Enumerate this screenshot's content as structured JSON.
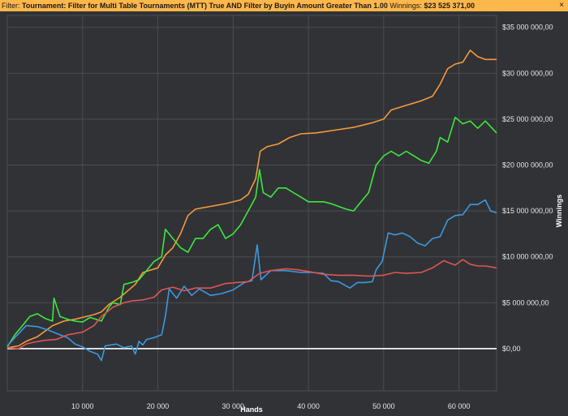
{
  "filter": {
    "label": "Filter:",
    "text": "Tournament: Filter for Multi Table Tournaments (MTT) True AND Filter by Buyin Amount Greater Than 1.00",
    "winnings_label": "Winnings:",
    "winnings_value": "$23 525 371,00",
    "close_glyph": "×"
  },
  "chart_data": {
    "type": "line",
    "xlabel": "Hands",
    "ylabel": "Winnings",
    "xlim": [
      0,
      65000
    ],
    "ylim": [
      -4600000,
      36300000
    ],
    "x_ticks": [
      10000,
      20000,
      30000,
      40000,
      50000,
      60000
    ],
    "x_tick_labels": [
      "10 000",
      "20 000",
      "30 000",
      "40 000",
      "50 000",
      "60 000"
    ],
    "y_ticks": [
      0,
      5000000,
      10000000,
      15000000,
      20000000,
      25000000,
      30000000,
      35000000
    ],
    "y_tick_labels": [
      "$0,00",
      "$5 000 000,00",
      "$10 000 000,00",
      "$15 000 000,00",
      "$20 000 000,00",
      "$25 000 000,00",
      "$30 000 000,00",
      "$35 000 000,00"
    ],
    "grid": true,
    "zero_line": true,
    "background": "#303236",
    "grid_color": "#4a4d52",
    "series": [
      {
        "color": "#f59a3b",
        "points": [
          [
            0,
            100000
          ],
          [
            1500,
            300000
          ],
          [
            2500,
            800000
          ],
          [
            4000,
            1300000
          ],
          [
            6000,
            2500000
          ],
          [
            7500,
            3000000
          ],
          [
            9000,
            3200000
          ],
          [
            10000,
            3400000
          ],
          [
            11500,
            3700000
          ],
          [
            12500,
            4000000
          ],
          [
            13500,
            4800000
          ],
          [
            15000,
            5600000
          ],
          [
            17000,
            7000000
          ],
          [
            18000,
            8300000
          ],
          [
            20000,
            8800000
          ],
          [
            21000,
            10200000
          ],
          [
            22000,
            11000000
          ],
          [
            23000,
            12500000
          ],
          [
            24000,
            14500000
          ],
          [
            25000,
            15200000
          ],
          [
            27000,
            15500000
          ],
          [
            29000,
            15800000
          ],
          [
            31000,
            16200000
          ],
          [
            32000,
            16800000
          ],
          [
            33000,
            18500000
          ],
          [
            33600,
            21500000
          ],
          [
            34500,
            22000000
          ],
          [
            36000,
            22300000
          ],
          [
            37500,
            23000000
          ],
          [
            39000,
            23400000
          ],
          [
            41000,
            23500000
          ],
          [
            43500,
            23800000
          ],
          [
            46000,
            24100000
          ],
          [
            47000,
            24300000
          ],
          [
            48500,
            24600000
          ],
          [
            50000,
            25000000
          ],
          [
            51000,
            26000000
          ],
          [
            53000,
            26500000
          ],
          [
            55000,
            27000000
          ],
          [
            56500,
            27500000
          ],
          [
            57500,
            28800000
          ],
          [
            58500,
            30500000
          ],
          [
            59500,
            31000000
          ],
          [
            60500,
            31200000
          ],
          [
            61500,
            32500000
          ],
          [
            62500,
            31800000
          ],
          [
            63500,
            31500000
          ],
          [
            65000,
            31500000
          ]
        ]
      },
      {
        "color": "#3ee83e",
        "points": [
          [
            0,
            200000
          ],
          [
            1000,
            1500000
          ],
          [
            2000,
            2500000
          ],
          [
            3000,
            3500000
          ],
          [
            4000,
            3800000
          ],
          [
            5000,
            3300000
          ],
          [
            6000,
            3000000
          ],
          [
            6200,
            5500000
          ],
          [
            7000,
            3500000
          ],
          [
            8000,
            3200000
          ],
          [
            9000,
            3000000
          ],
          [
            10000,
            2900000
          ],
          [
            11000,
            3400000
          ],
          [
            12500,
            3000000
          ],
          [
            13500,
            4500000
          ],
          [
            14000,
            5000000
          ],
          [
            15000,
            4800000
          ],
          [
            15500,
            7000000
          ],
          [
            16500,
            7200000
          ],
          [
            17500,
            7500000
          ],
          [
            18500,
            8500000
          ],
          [
            19500,
            9500000
          ],
          [
            20500,
            10000000
          ],
          [
            21000,
            13000000
          ],
          [
            22000,
            12000000
          ],
          [
            23000,
            11000000
          ],
          [
            24000,
            10500000
          ],
          [
            25000,
            12000000
          ],
          [
            26000,
            12000000
          ],
          [
            27000,
            13000000
          ],
          [
            28000,
            13500000
          ],
          [
            29000,
            12000000
          ],
          [
            30000,
            12500000
          ],
          [
            31000,
            13500000
          ],
          [
            32000,
            15000000
          ],
          [
            33000,
            16500000
          ],
          [
            33500,
            19500000
          ],
          [
            34000,
            17000000
          ],
          [
            35000,
            16500000
          ],
          [
            36000,
            17500000
          ],
          [
            37000,
            17500000
          ],
          [
            38000,
            17000000
          ],
          [
            39000,
            16500000
          ],
          [
            40000,
            16000000
          ],
          [
            42000,
            16000000
          ],
          [
            43000,
            15800000
          ],
          [
            45000,
            15200000
          ],
          [
            46000,
            15000000
          ],
          [
            47000,
            16000000
          ],
          [
            48000,
            17000000
          ],
          [
            49000,
            20000000
          ],
          [
            50000,
            21000000
          ],
          [
            51000,
            21500000
          ],
          [
            52000,
            21000000
          ],
          [
            53000,
            21500000
          ],
          [
            54000,
            21000000
          ],
          [
            55000,
            20500000
          ],
          [
            56000,
            20200000
          ],
          [
            57000,
            21500000
          ],
          [
            57500,
            23000000
          ],
          [
            58500,
            22500000
          ],
          [
            59500,
            25200000
          ],
          [
            60500,
            24500000
          ],
          [
            61500,
            24800000
          ],
          [
            62500,
            24000000
          ],
          [
            63500,
            24800000
          ],
          [
            65000,
            23500000
          ]
        ]
      },
      {
        "color": "#3d99df",
        "points": [
          [
            0,
            300000
          ],
          [
            1000,
            1200000
          ],
          [
            2500,
            2500000
          ],
          [
            4000,
            2400000
          ],
          [
            5500,
            2000000
          ],
          [
            7000,
            1500000
          ],
          [
            8000,
            1200000
          ],
          [
            9000,
            500000
          ],
          [
            10000,
            200000
          ],
          [
            11000,
            -300000
          ],
          [
            12000,
            -600000
          ],
          [
            12500,
            -1300000
          ],
          [
            13000,
            300000
          ],
          [
            14500,
            500000
          ],
          [
            15500,
            100000
          ],
          [
            16500,
            300000
          ],
          [
            17000,
            -600000
          ],
          [
            17500,
            800000
          ],
          [
            18000,
            400000
          ],
          [
            18500,
            1000000
          ],
          [
            19500,
            1200000
          ],
          [
            20500,
            1500000
          ],
          [
            21000,
            3500000
          ],
          [
            21500,
            6500000
          ],
          [
            22500,
            5500000
          ],
          [
            23500,
            6800000
          ],
          [
            24500,
            5800000
          ],
          [
            25500,
            6500000
          ],
          [
            27000,
            5800000
          ],
          [
            28500,
            6000000
          ],
          [
            30000,
            6400000
          ],
          [
            31500,
            7200000
          ],
          [
            32500,
            7400000
          ],
          [
            33200,
            11300000
          ],
          [
            33700,
            7500000
          ],
          [
            35000,
            8500000
          ],
          [
            37000,
            8500000
          ],
          [
            39000,
            8300000
          ],
          [
            40500,
            8300000
          ],
          [
            42000,
            8200000
          ],
          [
            43000,
            7400000
          ],
          [
            44000,
            7300000
          ],
          [
            45500,
            6600000
          ],
          [
            46500,
            7200000
          ],
          [
            47500,
            7200000
          ],
          [
            48500,
            7300000
          ],
          [
            49000,
            8600000
          ],
          [
            49800,
            9500000
          ],
          [
            50600,
            12600000
          ],
          [
            51500,
            12400000
          ],
          [
            52500,
            12600000
          ],
          [
            53500,
            12200000
          ],
          [
            54500,
            11500000
          ],
          [
            55500,
            11200000
          ],
          [
            56500,
            12000000
          ],
          [
            57500,
            12200000
          ],
          [
            58500,
            14000000
          ],
          [
            59500,
            14500000
          ],
          [
            60500,
            14600000
          ],
          [
            61500,
            15700000
          ],
          [
            62500,
            15700000
          ],
          [
            63500,
            16200000
          ],
          [
            64200,
            15000000
          ],
          [
            65000,
            14800000
          ]
        ]
      },
      {
        "color": "#e05552",
        "points": [
          [
            0,
            100000
          ],
          [
            1500,
            0
          ],
          [
            2500,
            500000
          ],
          [
            3500,
            700000
          ],
          [
            5000,
            900000
          ],
          [
            6500,
            1000000
          ],
          [
            8000,
            1500000
          ],
          [
            10000,
            1800000
          ],
          [
            11500,
            2500000
          ],
          [
            12500,
            3500000
          ],
          [
            14000,
            4500000
          ],
          [
            15500,
            5000000
          ],
          [
            16500,
            5200000
          ],
          [
            18000,
            5300000
          ],
          [
            19500,
            5600000
          ],
          [
            20500,
            6400000
          ],
          [
            22000,
            6700000
          ],
          [
            23500,
            6300000
          ],
          [
            25000,
            6600000
          ],
          [
            27000,
            6600000
          ],
          [
            29000,
            7100000
          ],
          [
            30500,
            7200000
          ],
          [
            32000,
            7300000
          ],
          [
            33500,
            8200000
          ],
          [
            35000,
            8500000
          ],
          [
            37000,
            8700000
          ],
          [
            38500,
            8600000
          ],
          [
            40000,
            8400000
          ],
          [
            42000,
            8100000
          ],
          [
            44000,
            8000000
          ],
          [
            46000,
            8000000
          ],
          [
            48000,
            7900000
          ],
          [
            50000,
            8000000
          ],
          [
            51500,
            8300000
          ],
          [
            53000,
            8200000
          ],
          [
            55000,
            8300000
          ],
          [
            56500,
            8800000
          ],
          [
            58000,
            9600000
          ],
          [
            58500,
            9400000
          ],
          [
            59500,
            9100000
          ],
          [
            60500,
            9700000
          ],
          [
            61500,
            9200000
          ],
          [
            62500,
            9000000
          ],
          [
            63500,
            9000000
          ],
          [
            65000,
            8800000
          ]
        ]
      }
    ]
  }
}
